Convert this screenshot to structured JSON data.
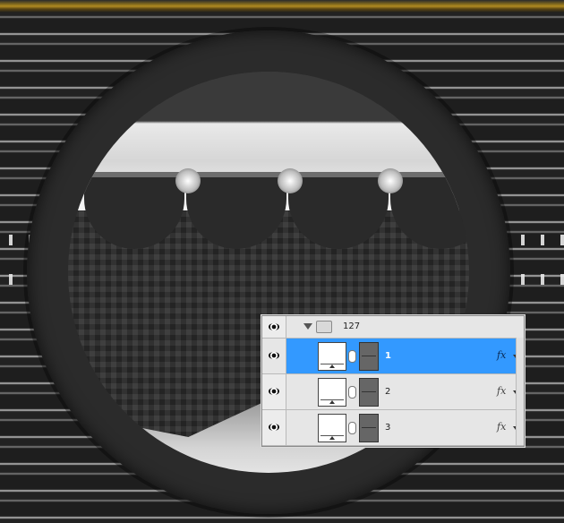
{
  "layers_panel": {
    "group": {
      "name": "127",
      "expanded": true,
      "icon": "folder-icon"
    },
    "layers": [
      {
        "name": "1",
        "selected": true,
        "fx": "fx",
        "icon": "eye-icon"
      },
      {
        "name": "2",
        "selected": false,
        "fx": "fx",
        "icon": "eye-icon"
      },
      {
        "name": "3",
        "selected": false,
        "fx": "fx",
        "icon": "eye-icon"
      }
    ],
    "selection_color": "#3399ff"
  }
}
